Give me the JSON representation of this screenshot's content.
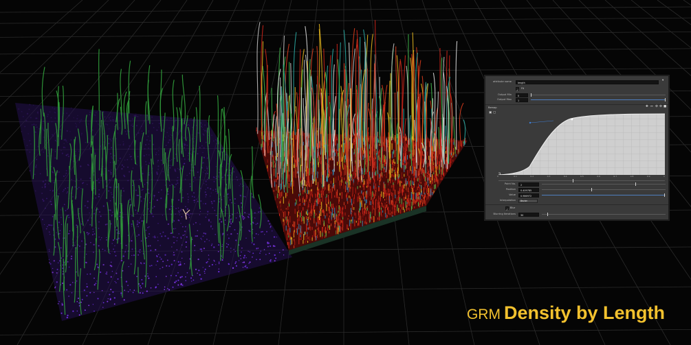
{
  "title": {
    "prefix": "GRM",
    "main": "Density by Length"
  },
  "panel": {
    "attribute_name_label": "attribute name",
    "attribute_name_value": "length",
    "remap_toggle_label": "Fit",
    "output_min_label": "Output Min",
    "output_min_value": "0",
    "output_max_label": "Output Max",
    "output_max_value": "1",
    "ramp_label": "Remap",
    "point_no_label": "Point No.",
    "point_no_value": "2",
    "position_label": "Position",
    "position_value": "0.409785",
    "value_label": "Value",
    "value_value": "0.986972",
    "interpolation_label": "Interpolation",
    "interpolation_value": "Bezier",
    "enable_toggle_label": "Blur",
    "blurring_iterations_label": "Blurring Iterations",
    "blurring_iterations_value": "30",
    "ramp_axis_ticks": [
      "0",
      "0.1",
      "0.2",
      "0.3",
      "0.4",
      "0.5",
      "0.6",
      "0.7",
      "0.8",
      "0.9",
      "1"
    ]
  },
  "colors": {
    "title": "#f2c12e",
    "curve_fill": "#d9d9d9",
    "handle": "#3f7fd6",
    "purple_points": "#7a35e0",
    "green_curves": "#2f9a3a"
  }
}
